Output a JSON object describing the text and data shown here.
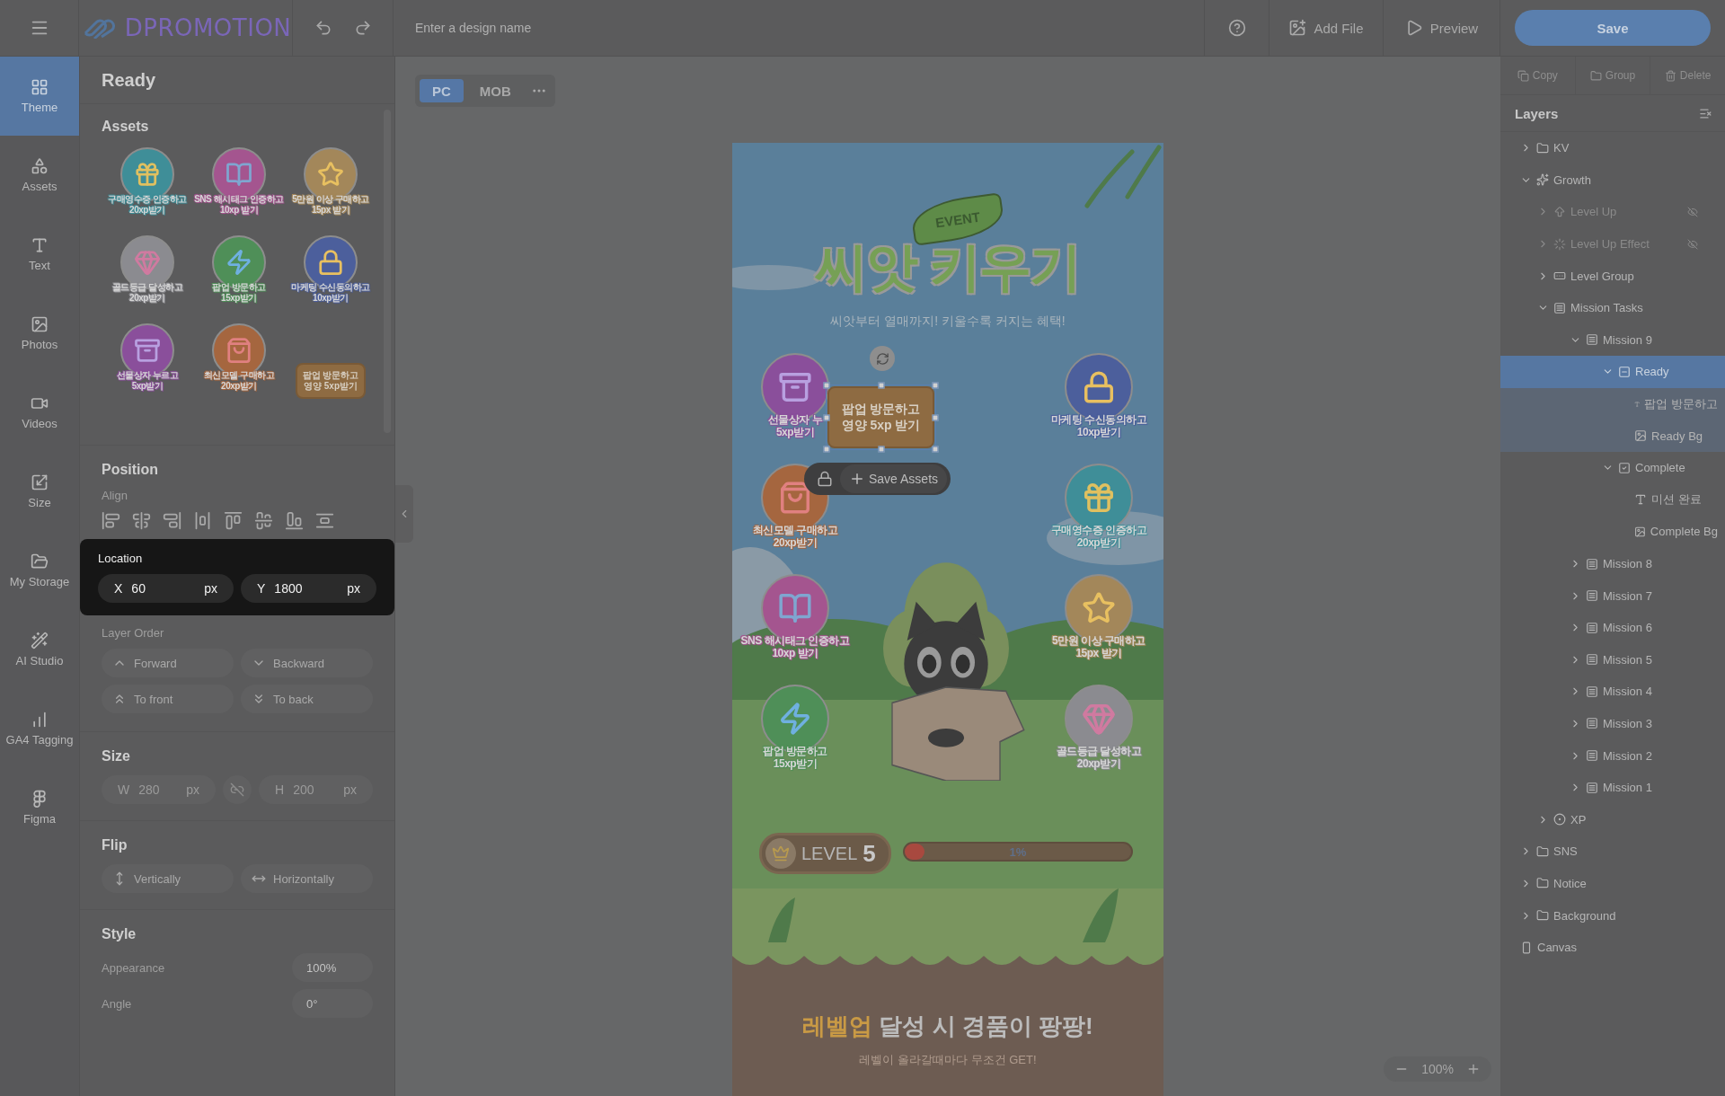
{
  "topbar": {
    "brand": "DPROMOTION",
    "design_name": {
      "placeholder": "Enter a design name"
    },
    "actions": [
      "Add File",
      "Preview"
    ],
    "save": "Save"
  },
  "sidebar": [
    {
      "label": "Theme",
      "selected": true
    },
    {
      "label": "Assets",
      "selected": false
    },
    {
      "label": "Text",
      "selected": false
    },
    {
      "label": "Photos",
      "selected": false
    },
    {
      "label": "Videos",
      "selected": false
    },
    {
      "label": "Size",
      "selected": false
    },
    {
      "label": "My Storage",
      "selected": false
    },
    {
      "label": "AI Studio",
      "selected": false
    },
    {
      "label": "GA4 Tagging",
      "selected": false
    },
    {
      "label": "Figma",
      "selected": false
    }
  ],
  "panel": {
    "title": "Ready",
    "assets_heading": "Assets",
    "assets": [
      {
        "kind": "gift",
        "color": "#3f8e98",
        "lines": [
          "구매영수증 인증하고",
          "20xp받기"
        ]
      },
      {
        "kind": "book",
        "color": "#a4558f",
        "lines": [
          "SNS 해시태그 인증하고",
          "10xp 받기"
        ]
      },
      {
        "kind": "coin",
        "color": "#a3875a",
        "lines": [
          "5만원 이상 구매하고",
          "15px 받기"
        ]
      },
      {
        "kind": "gem",
        "color": "#8b8b90",
        "lines": [
          "골드등급 달성하고",
          "20xp받기"
        ]
      },
      {
        "kind": "bolt",
        "color": "#4f8f58",
        "lines": [
          "팝업 방문하고",
          "15xp받기"
        ]
      },
      {
        "kind": "lock",
        "color": "#4c5f9c",
        "lines": [
          "마케팅 수신동의하고",
          "10xp받기"
        ]
      },
      {
        "kind": "chest",
        "color": "#8a4f9b",
        "lines": [
          "선물상자 누르고",
          "5xp받기"
        ]
      },
      {
        "kind": "bag",
        "color": "#a5663f",
        "lines": [
          "최신모델 구매하고",
          "20xp받기"
        ]
      },
      {
        "kind": "card",
        "color": "#8e6b42",
        "lines": [
          "팝업 방문하고",
          "영양 5xp받기"
        ]
      }
    ],
    "position": {
      "heading": "Position",
      "align_label": "Align",
      "location": {
        "label": "Location",
        "fields": [
          {
            "axis": "X",
            "value": "60",
            "unit": "px"
          },
          {
            "axis": "Y",
            "value": "1800",
            "unit": "px"
          }
        ]
      }
    },
    "layer_order": {
      "label": "Layer Order",
      "buttons": [
        "Forward",
        "Backward",
        "To front",
        "To back"
      ]
    },
    "size": {
      "heading": "Size",
      "fields": [
        {
          "axis": "W",
          "value": "280",
          "unit": "px",
          "disabled": true
        },
        {
          "axis": "H",
          "value": "200",
          "unit": "px",
          "disabled": true
        }
      ]
    },
    "flip": {
      "heading": "Flip",
      "buttons": [
        "Vertically",
        "Horizontally"
      ]
    },
    "style": {
      "heading": "Style",
      "rows": [
        {
          "label": "Appearance",
          "value": "100%"
        },
        {
          "label": "Angle",
          "value": "0°"
        }
      ]
    }
  },
  "canvas": {
    "views": [
      {
        "label": "PC",
        "selected": true
      },
      {
        "label": "MOB",
        "selected": false
      }
    ],
    "zoom": "100%",
    "design": {
      "badge": "EVENT",
      "title": "씨앗 키우기",
      "subtitle": "씨앗부터 열매까지! 키울수록 커지는 혜택!",
      "missions_left": [
        {
          "kind": "chest",
          "color": "#8a4f9b",
          "lines": [
            "선물상자 누",
            "5xp받기"
          ]
        },
        {
          "kind": "bag",
          "color": "#a5663f",
          "lines": [
            "최신모델 구매하고",
            "20xp받기"
          ]
        },
        {
          "kind": "book",
          "color": "#a4558f",
          "lines": [
            "SNS 해시태그 인증하고",
            "10xp 받기"
          ]
        },
        {
          "kind": "bolt",
          "color": "#4f8f58",
          "lines": [
            "팝업 방문하고",
            "15xp받기"
          ]
        }
      ],
      "missions_right": [
        {
          "kind": "lock",
          "color": "#4c5f9c",
          "lines": [
            "마케팅 수신동의하고",
            "10xp받기"
          ]
        },
        {
          "kind": "gift",
          "color": "#3f8e98",
          "lines": [
            "구매영수증 인증하고",
            "20xp받기"
          ]
        },
        {
          "kind": "coin",
          "color": "#a3875a",
          "lines": [
            "5만원 이상 구매하고",
            "15px 받기"
          ]
        },
        {
          "kind": "gem",
          "color": "#8b8b90",
          "lines": [
            "골드등급 달성하고",
            "20xp받기"
          ]
        }
      ],
      "selection": {
        "lines": [
          "팝업 방문하고",
          "영양 5xp 받기"
        ],
        "action": "Save Assets"
      },
      "level": {
        "label": "LEVEL",
        "value": "5"
      },
      "progress": {
        "level": 0.01,
        "reading": "1%"
      },
      "headline": "**레벨업** 달성 시 경품이 팡팡!",
      "subline": "레벨이 올라갈때마다 무조건 GET!"
    }
  },
  "layers": {
    "actions": [
      "Copy",
      "Group",
      "Delete"
    ],
    "title": "Layers",
    "tree": [
      {
        "label": "KV",
        "kind": "folder",
        "expanded": false,
        "selected": false,
        "hidden": false
      },
      {
        "label": "Growth",
        "kind": "sparkle",
        "expanded": true,
        "selected": false,
        "hidden": false,
        "children": [
          {
            "label": "Level Up",
            "kind": "arrow",
            "expanded": false,
            "selected": false,
            "hidden": true
          },
          {
            "label": "Level Up Effect",
            "kind": "effect",
            "expanded": false,
            "selected": false,
            "hidden": true
          },
          {
            "label": "Level Group",
            "kind": "frame",
            "expanded": false,
            "selected": false,
            "hidden": false
          },
          {
            "label": "Mission Tasks",
            "kind": "list",
            "expanded": true,
            "selected": false,
            "hidden": false,
            "children": [
              {
                "label": "Mission 9",
                "kind": "list",
                "expanded": true,
                "selected": false,
                "hidden": false,
                "children": [
                  {
                    "label": "Ready",
                    "kind": "minus",
                    "expanded": true,
                    "selected": true,
                    "hidden": false,
                    "children": [
                      {
                        "label": "팝업 방문하고",
                        "kind": "text",
                        "selected": false,
                        "hidden": false
                      },
                      {
                        "label": "Ready Bg",
                        "kind": "image",
                        "selected": false,
                        "hidden": false
                      }
                    ]
                  },
                  {
                    "label": "Complete",
                    "kind": "check",
                    "expanded": true,
                    "selected": false,
                    "hidden": false,
                    "children": [
                      {
                        "label": "미션 완료",
                        "kind": "text",
                        "selected": false,
                        "hidden": false
                      },
                      {
                        "label": "Complete Bg",
                        "kind": "image",
                        "selected": false,
                        "hidden": false
                      }
                    ]
                  }
                ]
              },
              {
                "label": "Mission 8",
                "kind": "list",
                "expanded": false,
                "selected": false,
                "hidden": false
              },
              {
                "label": "Mission 7",
                "kind": "list",
                "expanded": false,
                "selected": false,
                "hidden": false
              },
              {
                "label": "Mission 6",
                "kind": "list",
                "expanded": false,
                "selected": false,
                "hidden": false
              },
              {
                "label": "Mission 5",
                "kind": "list",
                "expanded": false,
                "selected": false,
                "hidden": false
              },
              {
                "label": "Mission 4",
                "kind": "list",
                "expanded": false,
                "selected": false,
                "hidden": false
              },
              {
                "label": "Mission 3",
                "kind": "list",
                "expanded": false,
                "selected": false,
                "hidden": false
              },
              {
                "label": "Mission 2",
                "kind": "list",
                "expanded": false,
                "selected": false,
                "hidden": false
              },
              {
                "label": "Mission 1",
                "kind": "list",
                "expanded": false,
                "selected": false,
                "hidden": false
              }
            ]
          },
          {
            "label": "XP",
            "kind": "xp",
            "expanded": false,
            "selected": false,
            "hidden": false
          }
        ]
      },
      {
        "label": "SNS",
        "kind": "folder",
        "expanded": false,
        "selected": false,
        "hidden": false
      },
      {
        "label": "Notice",
        "kind": "folder",
        "expanded": false,
        "selected": false,
        "hidden": false
      },
      {
        "label": "Background",
        "kind": "folder",
        "expanded": false,
        "selected": false,
        "hidden": false
      },
      {
        "label": "Canvas",
        "kind": "canvas",
        "selected": false,
        "hidden": false
      }
    ]
  }
}
